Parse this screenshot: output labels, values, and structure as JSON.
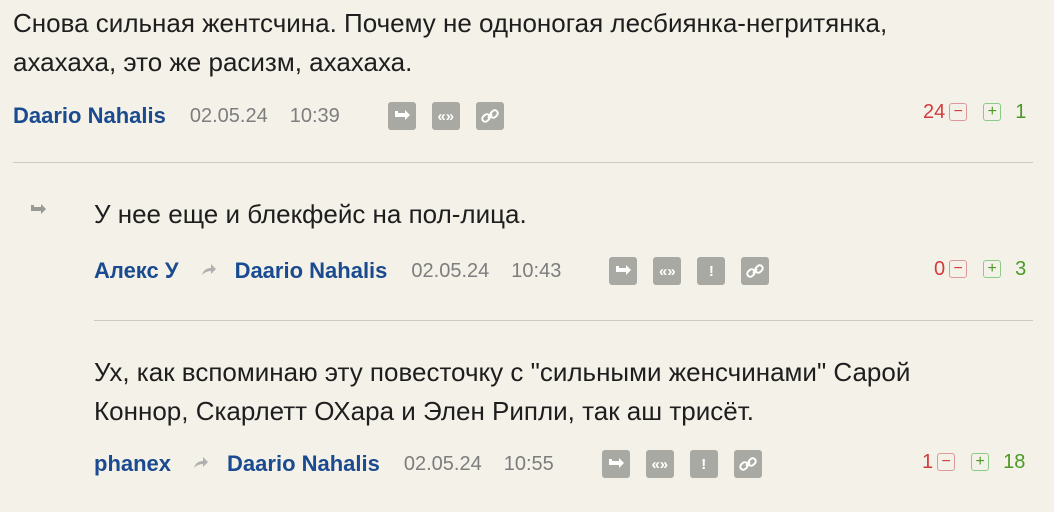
{
  "comments": [
    {
      "text": "Снова сильная жентсчина. Почему не одноногая лесбиянка-негритянка,\nахахаха, это же расизм, ахахаха.",
      "author": "Daario Nahalis",
      "date": "02.05.24",
      "time": "10:39",
      "downvotes": "24",
      "upvotes": "1"
    },
    {
      "text": "У нее еще и блекфейс на пол-лица.",
      "author": "Алекс У",
      "reply_to": "Daario Nahalis",
      "date": "02.05.24",
      "time": "10:43",
      "downvotes": "0",
      "upvotes": "3"
    },
    {
      "text": "Ух, как вспоминаю эту повесточку с \"сильными женсчинами\" Сарой\nКоннор, Скарлетт ОХара и Элен Рипли, так аш трисёт.",
      "author": "phanex",
      "reply_to": "Daario Nahalis",
      "date": "02.05.24",
      "time": "10:55",
      "downvotes": "1",
      "upvotes": "18"
    }
  ],
  "icons": {
    "reply": "↳",
    "quote": "«»",
    "report": "!",
    "link": "🔗"
  },
  "colors": {
    "background": "#f4f1e8",
    "author": "#1a4a8f",
    "negative": "#d23c3c",
    "positive": "#4a9a25",
    "icon_bg": "#a9a9a3"
  }
}
